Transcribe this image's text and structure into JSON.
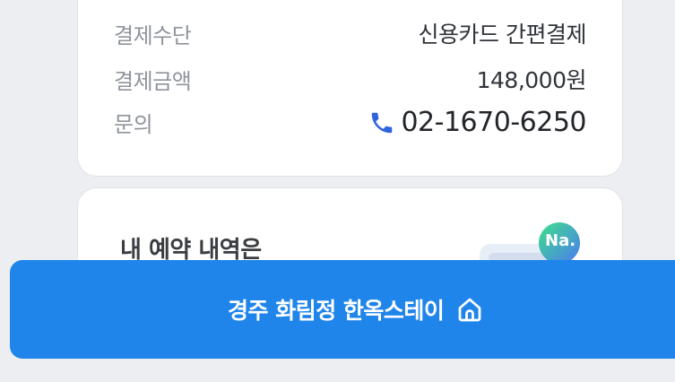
{
  "payment": {
    "method_label": "결제수단",
    "method_value": "신용카드 간편결제",
    "amount_label": "결제금액",
    "amount_value": "148,000원",
    "inquiry_label": "문의",
    "inquiry_phone": "02-1670-6250"
  },
  "reservation": {
    "title": "내 예약 내역은",
    "badge_text": "Na."
  },
  "bottom_bar": {
    "label": "경주 화림정 한옥스테이",
    "icon": "home-icon",
    "color": "#1f85ea"
  },
  "colors": {
    "background": "#eceef1",
    "phone_icon": "#2f63e0"
  }
}
